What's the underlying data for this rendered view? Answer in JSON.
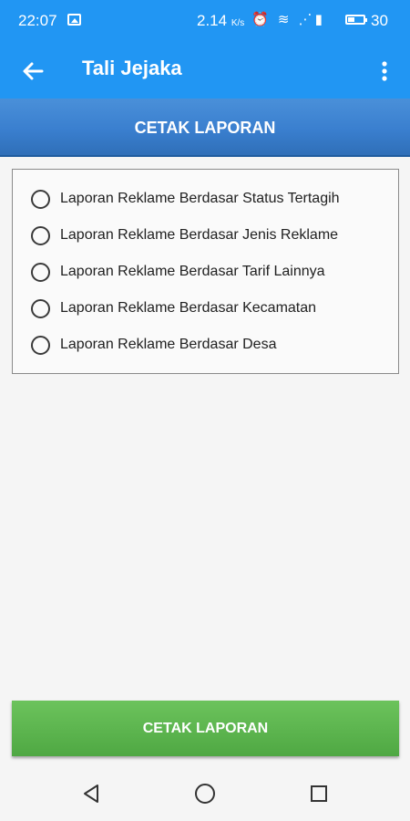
{
  "status_bar": {
    "time": "22:07",
    "speed": "2.14",
    "speed_unit": "K/s",
    "battery": "30",
    "icons": [
      "image-icon",
      "alarm-icon",
      "wifi-icon",
      "signal-icon",
      "battery-icon"
    ]
  },
  "app_bar": {
    "title": "Tali Jejaka",
    "back_icon": "arrow-left-icon",
    "menu_icon": "more-vertical-icon"
  },
  "header": {
    "title": "CETAK LAPORAN"
  },
  "report_options": [
    {
      "label": "Laporan Reklame Berdasar Status Tertagih",
      "selected": false
    },
    {
      "label": "Laporan Reklame Berdasar Jenis Reklame",
      "selected": false
    },
    {
      "label": "Laporan Reklame Berdasar Tarif Lainnya",
      "selected": false
    },
    {
      "label": "Laporan Reklame Berdasar Kecamatan",
      "selected": false
    },
    {
      "label": "Laporan Reklame Berdasar Desa",
      "selected": false
    }
  ],
  "print_button": {
    "label": "CETAK LAPORAN"
  },
  "nav_bar": {
    "icons": [
      "back-triangle-icon",
      "home-circle-icon",
      "recents-square-icon"
    ]
  },
  "colors": {
    "primary": "#2196f3",
    "header_band": "#3a7fcf",
    "button_green": "#5cb54e"
  }
}
